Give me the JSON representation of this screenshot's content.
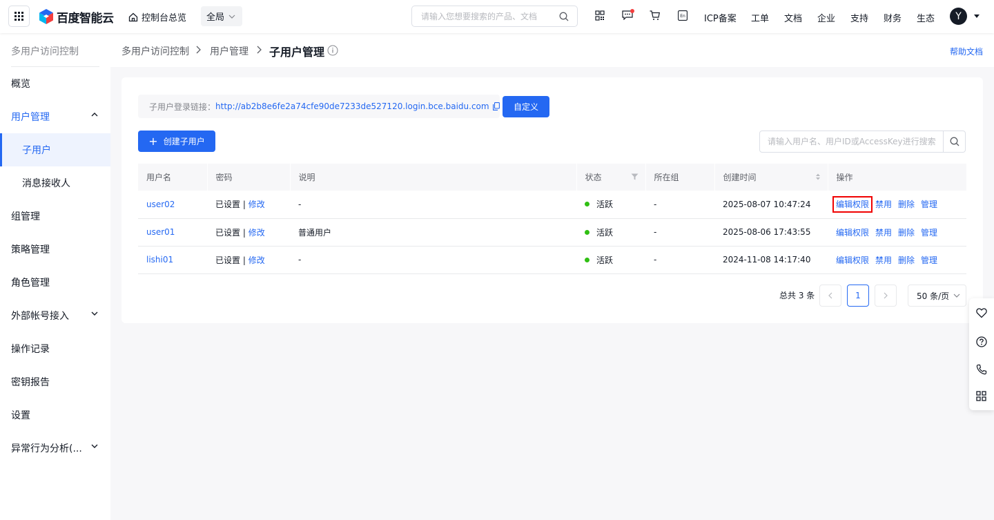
{
  "topbar": {
    "logo_text": "百度智能云",
    "console_label": "控制台总览",
    "region": "全局",
    "search_placeholder": "请输入您想要搜索的产品、文档",
    "nav": [
      "ICP备案",
      "工单",
      "文档",
      "企业",
      "支持",
      "财务",
      "生态"
    ],
    "avatar_letter": "Y",
    "icons": [
      "apps-grid-icon",
      "home-icon",
      "qrcode-icon",
      "message-icon",
      "cart-icon",
      "language-en-icon",
      "search-icon"
    ]
  },
  "sidebar": {
    "title": "多用户访问控制",
    "items": [
      {
        "label": "概览"
      },
      {
        "label": "用户管理"
      },
      {
        "label": "子用户"
      },
      {
        "label": "消息接收人"
      },
      {
        "label": "组管理"
      },
      {
        "label": "策略管理"
      },
      {
        "label": "角色管理"
      },
      {
        "label": "外部帐号接入"
      },
      {
        "label": "操作记录"
      },
      {
        "label": "密钥报告"
      },
      {
        "label": "设置"
      },
      {
        "label": "异常行为分析(..."
      }
    ]
  },
  "breadcrumb": {
    "items": [
      "多用户访问控制",
      "用户管理"
    ],
    "current": "子用户管理",
    "help": "帮助文档"
  },
  "main": {
    "login_label": "子用户登录链接：",
    "login_url": "http://ab2b8e6fe2a74cfe90de7233de527120.login.bce.baidu.com",
    "customize_button": "自定义",
    "create_button": "创建子用户",
    "search_placeholder": "请输入用户名、用户ID或AccessKey进行搜索",
    "columns": [
      "用户名",
      "密码",
      "说明",
      "状态",
      "所在组",
      "创建时间",
      "操作"
    ],
    "rows": [
      {
        "username": "user02",
        "password": "已设置",
        "modify": "修改",
        "desc": "-",
        "status": "活跃",
        "group": "-",
        "created": "2025-08-07 10:47:24"
      },
      {
        "username": "user01",
        "password": "已设置",
        "modify": "修改",
        "desc": "普通用户",
        "status": "活跃",
        "group": "-",
        "created": "2025-08-06 17:43:55"
      },
      {
        "username": "lishi01",
        "password": "已设置",
        "modify": "修改",
        "desc": "-",
        "status": "活跃",
        "group": "-",
        "created": "2024-11-08 14:17:40"
      }
    ],
    "password_sep": "|",
    "actions": [
      "编辑权限",
      "禁用",
      "删除",
      "管理"
    ],
    "pagination": {
      "total": "总共 3 条",
      "current_page": "1",
      "page_size": "50 条/页"
    },
    "colors": {
      "primary": "#2468f2",
      "active_dot": "#30bf13",
      "highlight_box": "#f00000"
    }
  }
}
